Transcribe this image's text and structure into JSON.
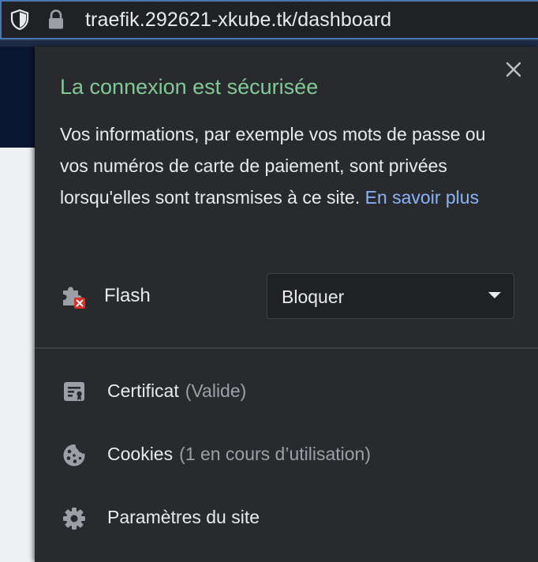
{
  "address_bar": {
    "url": "traefik.292621-xkube.tk/dashboard",
    "shield_icon": "shield-icon",
    "lock_icon": "lock-icon"
  },
  "popup": {
    "title": "La connexion est sécurisée",
    "description": "Vos informations, par exemple vos mots de passe ou vos numéros de carte de paiement, sont privées lorsqu'elles sont transmises à ce site.",
    "learn_more": "En savoir plus",
    "close_icon": "close-icon",
    "flash": {
      "label": "Flash",
      "icon": "puzzle-blocked-icon",
      "selected": "Bloquer"
    },
    "menu": [
      {
        "label": "Certificat",
        "sub": "(Valide)",
        "icon": "certificate-icon"
      },
      {
        "label": "Cookies",
        "sub": "(1 en cours d’utilisation)",
        "icon": "cookie-icon"
      },
      {
        "label": "Paramètres du site",
        "sub": "",
        "icon": "gear-icon"
      }
    ]
  },
  "colors": {
    "title_green": "#81c995",
    "link_blue": "#8ab4f8",
    "popup_bg": "#292a2d",
    "text": "#e8eaed",
    "muted": "#9aa0a6"
  }
}
